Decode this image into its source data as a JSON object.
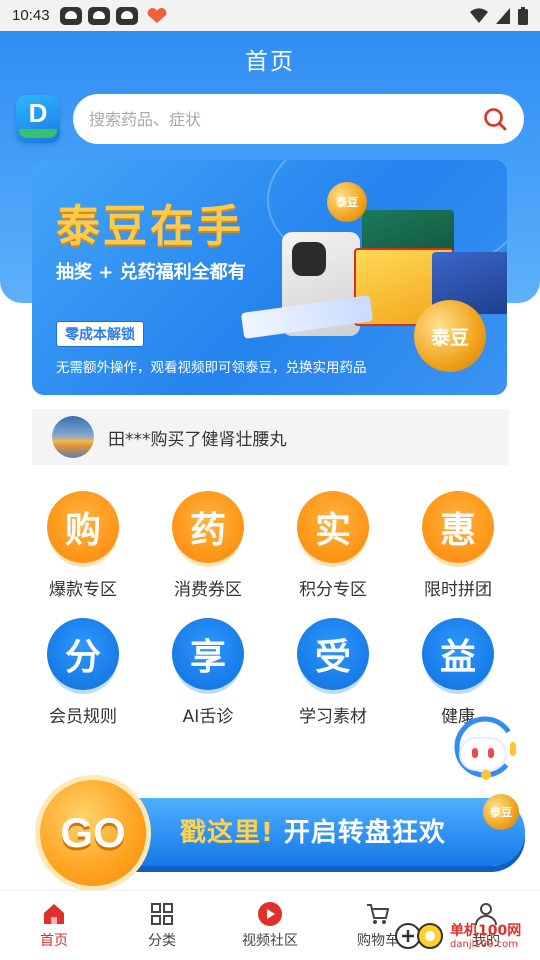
{
  "status_bar": {
    "time": "10:43"
  },
  "header": {
    "title": "首页",
    "logo_text": "D"
  },
  "search": {
    "placeholder": "搜索药品、症状"
  },
  "banner": {
    "title": "泰豆在手",
    "subtitle": "抽奖 + 兑药福利全都有",
    "button_label": "零成本解锁",
    "description": "无需额外操作，观看视频即可领泰豆，兑换实用药品",
    "coin_label": "泰豆"
  },
  "ticker": {
    "text": "田***购买了健肾壮腰丸"
  },
  "grid": [
    {
      "glyph": "购",
      "label": "爆款专区",
      "color": "orange"
    },
    {
      "glyph": "药",
      "label": "消费券区",
      "color": "orange"
    },
    {
      "glyph": "实",
      "label": "积分专区",
      "color": "orange"
    },
    {
      "glyph": "惠",
      "label": "限时拼团",
      "color": "orange"
    },
    {
      "glyph": "分",
      "label": "会员规则",
      "color": "blue"
    },
    {
      "glyph": "享",
      "label": "AI舌诊",
      "color": "blue"
    },
    {
      "glyph": "受",
      "label": "学习素材",
      "color": "blue"
    },
    {
      "glyph": "益",
      "label": "健康",
      "color": "blue"
    }
  ],
  "go_banner": {
    "ball": "GO",
    "highlight": "戳这里!",
    "text": "开启转盘狂欢",
    "coin": "泰豆"
  },
  "nav": [
    {
      "label": "首页",
      "icon": "home-icon",
      "active": true
    },
    {
      "label": "分类",
      "icon": "grid-icon",
      "active": false
    },
    {
      "label": "视频社区",
      "icon": "play-icon",
      "active": false
    },
    {
      "label": "购物车",
      "icon": "cart-icon",
      "active": false
    },
    {
      "label": "我的",
      "icon": "user-icon",
      "active": false
    }
  ],
  "watermark": {
    "text": "单机100网",
    "sub": "danji100.com"
  },
  "colors": {
    "primary_blue": "#2f8df3",
    "accent_orange": "#ff9a1c",
    "nav_active": "#e0302a"
  }
}
